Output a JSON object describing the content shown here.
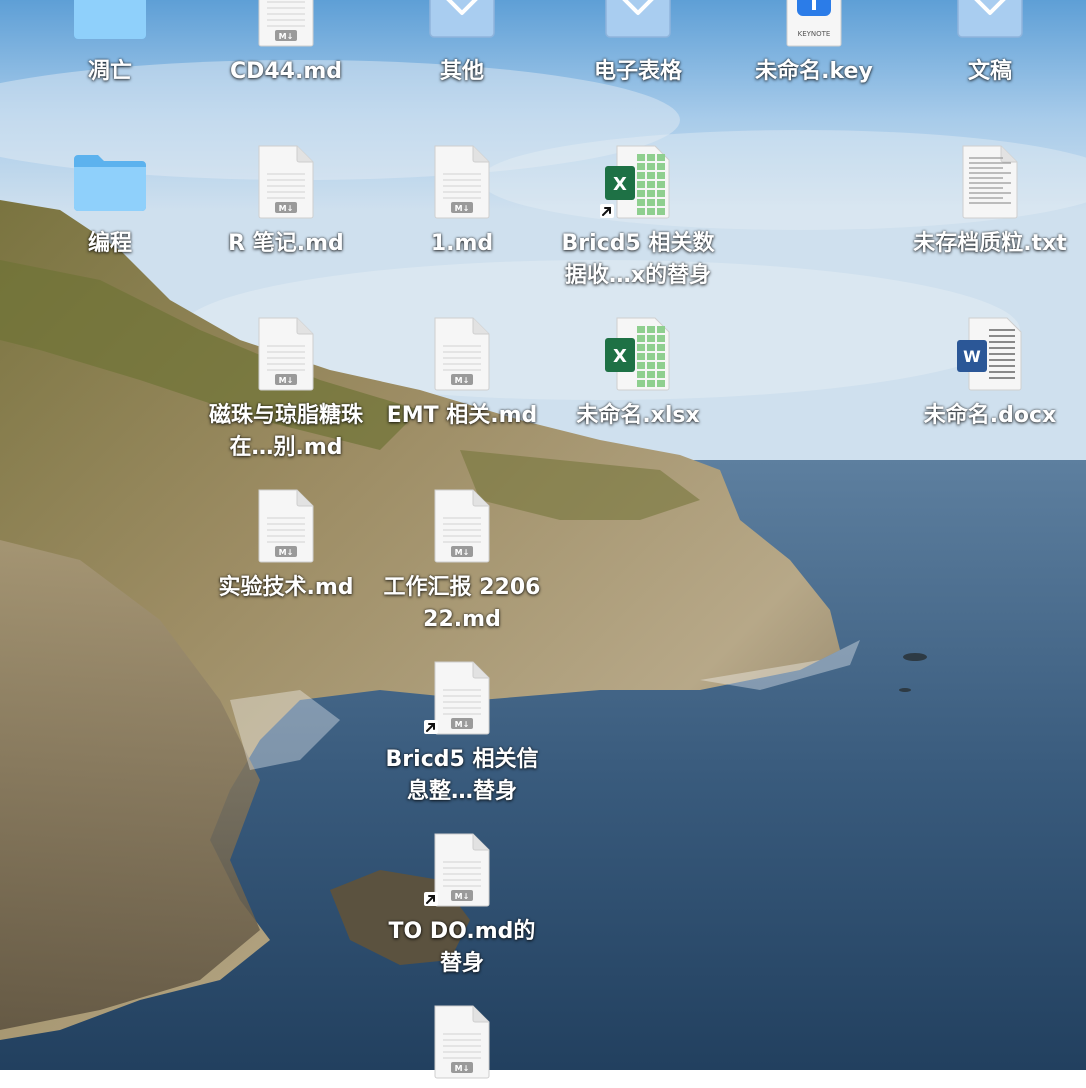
{
  "desktop": {
    "items": [
      {
        "id": "diaowang",
        "label": "凋亡",
        "icon": "folder-icon",
        "col": 0,
        "row": 0,
        "alias": false
      },
      {
        "id": "cd44",
        "label": "CD44.md",
        "icon": "markdown-file-icon",
        "col": 1,
        "row": 0,
        "alias": false
      },
      {
        "id": "qita",
        "label": "其他",
        "icon": "smart-folder-icon",
        "col": 2,
        "row": 0,
        "alias": false
      },
      {
        "id": "dianzibiaoge",
        "label": "电子表格",
        "icon": "smart-folder-icon",
        "col": 3,
        "row": 0,
        "alias": false
      },
      {
        "id": "weimingming-key",
        "label": "未命名.key",
        "icon": "keynote-file-icon",
        "col": 4,
        "row": 0,
        "alias": false,
        "badge": "KEYNOTE"
      },
      {
        "id": "wengao",
        "label": "文稿",
        "icon": "smart-folder-icon",
        "col": 5,
        "row": 0,
        "alias": false
      },
      {
        "id": "biancheng",
        "label": "编程",
        "icon": "folder-icon",
        "col": 0,
        "row": 1,
        "alias": false
      },
      {
        "id": "r-biji",
        "label": "R 笔记.md",
        "icon": "markdown-file-icon",
        "col": 1,
        "row": 1,
        "alias": false
      },
      {
        "id": "one-md",
        "label": "1.md",
        "icon": "markdown-file-icon",
        "col": 2,
        "row": 1,
        "alias": false
      },
      {
        "id": "bricd5-data",
        "label": "Bricd5 相关数据收…x的替身",
        "icon": "excel-file-icon",
        "col": 3,
        "row": 1,
        "alias": true,
        "badge": "X"
      },
      {
        "id": "weicundang",
        "label": "未存档质粒.txt",
        "icon": "text-file-icon",
        "col": 5,
        "row": 1,
        "alias": false
      },
      {
        "id": "cizhu",
        "label": "磁珠与琼脂糖珠在…别.md",
        "icon": "markdown-file-icon",
        "col": 1,
        "row": 2,
        "alias": false
      },
      {
        "id": "emt",
        "label": "EMT 相关.md",
        "icon": "markdown-file-icon",
        "col": 2,
        "row": 2,
        "alias": false
      },
      {
        "id": "weimingming-xlsx",
        "label": "未命名.xlsx",
        "icon": "excel-file-icon",
        "col": 3,
        "row": 2,
        "alias": false,
        "badge": "X"
      },
      {
        "id": "weimingming-docx",
        "label": "未命名.docx",
        "icon": "word-file-icon",
        "col": 5,
        "row": 2,
        "alias": false,
        "badge": "W"
      },
      {
        "id": "shiyanjishu",
        "label": "实验技术.md",
        "icon": "markdown-file-icon",
        "col": 1,
        "row": 3,
        "alias": false
      },
      {
        "id": "gongzuohuibao",
        "label": "工作汇报 220622.md",
        "icon": "markdown-file-icon",
        "col": 2,
        "row": 3,
        "alias": false
      },
      {
        "id": "bricd5-info",
        "label": "Bricd5 相关信息整…替身",
        "icon": "markdown-file-icon",
        "col": 2,
        "row": 4,
        "alias": true
      },
      {
        "id": "todo",
        "label": "TO DO.md的替身",
        "icon": "markdown-file-icon",
        "col": 2,
        "row": 5,
        "alias": true
      },
      {
        "id": "bottom-file",
        "label": "",
        "icon": "markdown-file-icon",
        "col": 2,
        "row": 6,
        "alias": false
      }
    ],
    "md_badge": "M↓"
  },
  "colors": {
    "folder_light": "#8fd0fb",
    "folder_dark": "#5cb2ee",
    "smart_folder": "#a9cdf0",
    "excel_green": "#1e7145",
    "word_blue": "#2b5797",
    "keynote_blue": "#2b7ce8"
  }
}
